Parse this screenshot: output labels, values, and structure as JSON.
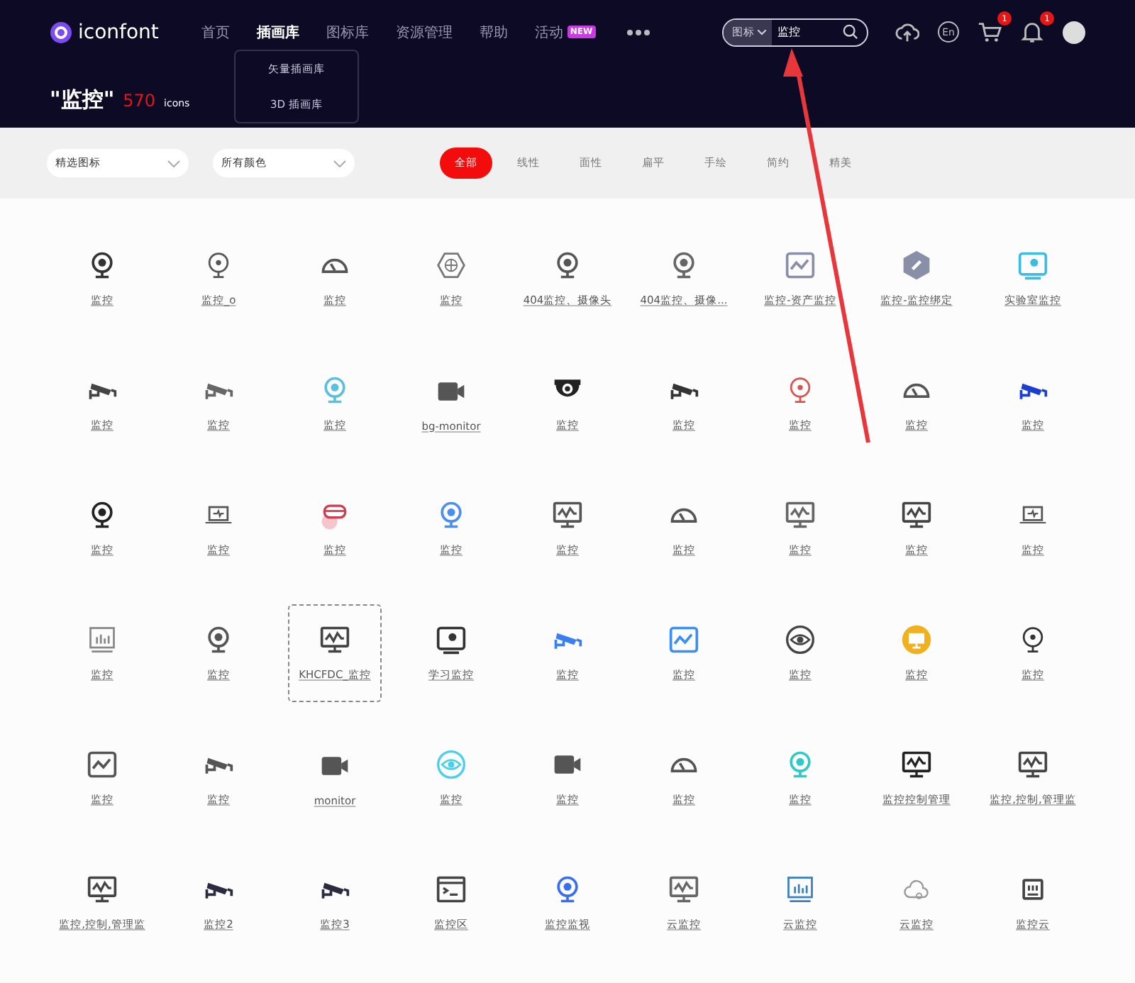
{
  "header": {
    "logo": "iconfont",
    "nav": [
      {
        "label": "首页",
        "selected": false
      },
      {
        "label": "插画库",
        "selected": true
      },
      {
        "label": "图标库",
        "selected": false
      },
      {
        "label": "资源管理",
        "selected": false
      },
      {
        "label": "帮助",
        "selected": false
      },
      {
        "label": "活动",
        "selected": false,
        "badge": "NEW"
      }
    ],
    "dropdown": [
      "矢量插画库",
      "3D 插画库"
    ],
    "search": {
      "scope": "图标",
      "value": "监控"
    },
    "cart_count": "1",
    "notification_count": "1",
    "lang": "En",
    "query": "\"监控\"",
    "count": "570",
    "count_unit": "icons"
  },
  "filters": {
    "selects": [
      "精选图标",
      "所有颜色"
    ],
    "styles": [
      {
        "label": "全部",
        "selected": true
      },
      {
        "label": "线性",
        "selected": false
      },
      {
        "label": "面性",
        "selected": false
      },
      {
        "label": "扁平",
        "selected": false
      },
      {
        "label": "手绘",
        "selected": false
      },
      {
        "label": "简约",
        "selected": false
      },
      {
        "label": "精美",
        "selected": false
      }
    ]
  },
  "icons": [
    {
      "label": "监控",
      "kind": "webcam",
      "color": "#333333",
      "selected": false
    },
    {
      "label": "监控_o",
      "kind": "pin",
      "color": "#555555",
      "selected": false
    },
    {
      "label": "监控",
      "kind": "gauge",
      "color": "#555555",
      "selected": false
    },
    {
      "label": "监控",
      "kind": "hexagon",
      "color": "#777777",
      "selected": false
    },
    {
      "label": "404监控、摄像头",
      "kind": "webcam",
      "color": "#555555",
      "selected": false
    },
    {
      "label": "404监控、摄像...",
      "kind": "webcam",
      "color": "#666666",
      "selected": false
    },
    {
      "label": "监控-资产监控",
      "kind": "chartbox",
      "color": "#8a8fa8",
      "selected": false
    },
    {
      "label": "监控-监控绑定",
      "kind": "hexlink",
      "color": "#8a8fa8",
      "selected": false
    },
    {
      "label": "实验室监控",
      "kind": "screen",
      "color": "#3bbce0",
      "selected": false
    },
    {
      "label": "监控",
      "kind": "cctv",
      "color": "#444444",
      "selected": false
    },
    {
      "label": "监控",
      "kind": "cctv",
      "color": "#666666",
      "selected": false
    },
    {
      "label": "监控",
      "kind": "webcam",
      "color": "#5bc0de",
      "selected": false
    },
    {
      "label": "bg-monitor",
      "kind": "video",
      "color": "#555555",
      "selected": false
    },
    {
      "label": "监控",
      "kind": "dome",
      "color": "#222222",
      "selected": false
    },
    {
      "label": "监控",
      "kind": "cctv",
      "color": "#333333",
      "selected": false
    },
    {
      "label": "监控",
      "kind": "pin",
      "color": "#d9534f",
      "selected": false
    },
    {
      "label": "监控",
      "kind": "gauge",
      "color": "#555555",
      "selected": false
    },
    {
      "label": "监控",
      "kind": "cctv",
      "color": "#1a3fd1",
      "selected": false
    },
    {
      "label": "监控",
      "kind": "webcam",
      "color": "#222222",
      "selected": false
    },
    {
      "label": "监控",
      "kind": "laptop",
      "color": "#555555",
      "selected": false
    },
    {
      "label": "监控",
      "kind": "vr",
      "color": "#d23a4f",
      "selected": false
    },
    {
      "label": "监控",
      "kind": "webcam",
      "color": "#4a8ef0",
      "selected": false
    },
    {
      "label": "监控",
      "kind": "monitor",
      "color": "#555555",
      "selected": false
    },
    {
      "label": "监控",
      "kind": "gauge",
      "color": "#555555",
      "selected": false
    },
    {
      "label": "监控",
      "kind": "monitor",
      "color": "#666666",
      "selected": false
    },
    {
      "label": "监控",
      "kind": "monitor",
      "color": "#444444",
      "selected": false
    },
    {
      "label": "监控",
      "kind": "laptop",
      "color": "#555555",
      "selected": false
    },
    {
      "label": "监控",
      "kind": "bars",
      "color": "#888888",
      "selected": false
    },
    {
      "label": "监控",
      "kind": "webcam",
      "color": "#555555",
      "selected": false
    },
    {
      "label": "KHCFDC_监控",
      "kind": "monitor",
      "color": "#444444",
      "selected": true
    },
    {
      "label": "学习监控",
      "kind": "screen",
      "color": "#333333",
      "selected": false
    },
    {
      "label": "监控",
      "kind": "cctv",
      "color": "#3a7ff0",
      "selected": false
    },
    {
      "label": "监控",
      "kind": "chartbox",
      "color": "#3a8ff0",
      "selected": false
    },
    {
      "label": "监控",
      "kind": "eye",
      "color": "#444444",
      "selected": false
    },
    {
      "label": "监控",
      "kind": "badge",
      "color": "#f0b020",
      "selected": false
    },
    {
      "label": "监控",
      "kind": "pin",
      "color": "#333333",
      "selected": false
    },
    {
      "label": "监控",
      "kind": "chartbox",
      "color": "#555555",
      "selected": false
    },
    {
      "label": "监控",
      "kind": "cctv",
      "color": "#555555",
      "selected": false
    },
    {
      "label": "monitor",
      "kind": "video",
      "color": "#555555",
      "selected": false
    },
    {
      "label": "监控",
      "kind": "eye",
      "color": "#4ad0e8",
      "selected": false
    },
    {
      "label": "监控",
      "kind": "video",
      "color": "#555555",
      "selected": false
    },
    {
      "label": "监控",
      "kind": "gauge",
      "color": "#555555",
      "selected": false
    },
    {
      "label": "监控",
      "kind": "webcam",
      "color": "#2fc9c9",
      "selected": false
    },
    {
      "label": "监控控制管理",
      "kind": "monitor",
      "color": "#222222",
      "selected": false
    },
    {
      "label": "监控,控制,管理监",
      "kind": "monitor",
      "color": "#444444",
      "selected": false
    },
    {
      "label": "监控,控制,管理监",
      "kind": "monitor",
      "color": "#444444",
      "selected": false
    },
    {
      "label": "监控2",
      "kind": "cctv",
      "color": "#2a2a40",
      "selected": false
    },
    {
      "label": "监控3",
      "kind": "cctv",
      "color": "#2a2a40",
      "selected": false
    },
    {
      "label": "监控区",
      "kind": "terminal",
      "color": "#444444",
      "selected": false
    },
    {
      "label": "监控监视",
      "kind": "webcam",
      "color": "#3a6ef0",
      "selected": false
    },
    {
      "label": "云监控",
      "kind": "monitor",
      "color": "#666666",
      "selected": false
    },
    {
      "label": "云监控",
      "kind": "bars",
      "color": "#3a7fc0",
      "selected": false
    },
    {
      "label": "云监控",
      "kind": "cloud",
      "color": "#999999",
      "selected": false
    },
    {
      "label": "监控云",
      "kind": "square",
      "color": "#444444",
      "selected": false
    }
  ]
}
